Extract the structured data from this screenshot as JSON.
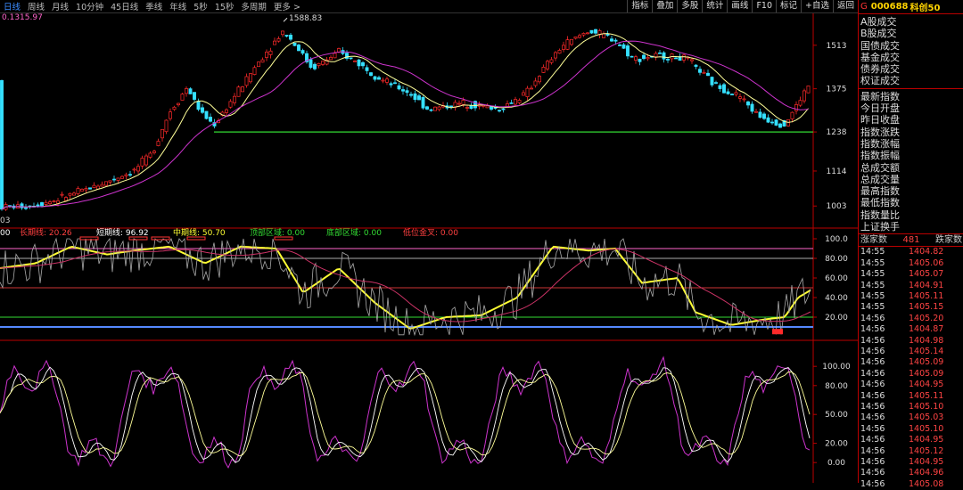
{
  "periods": [
    "日线",
    "周线",
    "月线",
    "10分钟",
    "45日线",
    "季线",
    "年线",
    "5秒",
    "15秒",
    "多周期",
    "更多 >"
  ],
  "active_period_index": 0,
  "tools": [
    "指标",
    "叠加",
    "多股",
    "统计",
    "画线",
    "F10",
    "标记",
    "+自选",
    "返回"
  ],
  "stock": {
    "flag": "G",
    "code": "000688",
    "name": "科创50"
  },
  "main_chart": {
    "top_left_value": "0.1315.97",
    "bottom_left_label": "03",
    "high_marker": "1588.83",
    "price_axis": [
      "1513",
      "1375",
      "1238",
      "1114",
      "1003"
    ],
    "support_line": 1238
  },
  "indicator1": {
    "legend": [
      {
        "text": "00",
        "color": "#ffffff"
      },
      {
        "text": "长期线: 20.26",
        "color": "#ff4040"
      },
      {
        "text": "短期线: 96.92",
        "color": "#ffffff"
      },
      {
        "text": "中期线: 50.70",
        "color": "#ffff33"
      },
      {
        "text": "顶部区域: 0.00",
        "color": "#33dd33"
      },
      {
        "text": "底部区域: 0.00",
        "color": "#33dd33"
      },
      {
        "text": "低位金叉: 0.00",
        "color": "#ff4040"
      }
    ],
    "axis": [
      "100.0",
      "80.00",
      "60.00",
      "40.00",
      "20.00"
    ]
  },
  "indicator2": {
    "axis": [
      "100.00",
      "80.00",
      "50.00",
      "20.00",
      "0.00"
    ]
  },
  "menu": {
    "group1": [
      "A股成交",
      "B股成交",
      "国债成交",
      "基金成交",
      "债券成交",
      "权证成交"
    ],
    "group2": [
      "最新指数",
      "今日开盘",
      "昨日收盘",
      "指数涨跌",
      "指数涨幅",
      "指数振幅",
      "总成交额",
      "总成交量",
      "最高指数",
      "最低指数",
      "指数量比",
      "上证换手"
    ]
  },
  "breadth": {
    "up_label": "涨家数",
    "up_value": "481",
    "down_label": "跌家数"
  },
  "ticks": [
    {
      "time": "14:55",
      "price": "1404.82"
    },
    {
      "time": "14:55",
      "price": "1405.06"
    },
    {
      "time": "14:55",
      "price": "1405.07"
    },
    {
      "time": "14:55",
      "price": "1404.91"
    },
    {
      "time": "14:55",
      "price": "1405.11"
    },
    {
      "time": "14:55",
      "price": "1405.15"
    },
    {
      "time": "14:56",
      "price": "1405.20"
    },
    {
      "time": "14:56",
      "price": "1404.87"
    },
    {
      "time": "14:56",
      "price": "1404.98"
    },
    {
      "time": "14:56",
      "price": "1405.14"
    },
    {
      "time": "14:56",
      "price": "1405.09"
    },
    {
      "time": "14:56",
      "price": "1405.09"
    },
    {
      "time": "14:56",
      "price": "1404.95"
    },
    {
      "time": "14:56",
      "price": "1405.11"
    },
    {
      "time": "14:56",
      "price": "1405.10"
    },
    {
      "time": "14:56",
      "price": "1405.03"
    },
    {
      "time": "14:56",
      "price": "1405.10"
    },
    {
      "time": "14:56",
      "price": "1404.95"
    },
    {
      "time": "14:56",
      "price": "1405.12"
    },
    {
      "time": "14:56",
      "price": "1404.95"
    },
    {
      "time": "14:56",
      "price": "1404.96"
    },
    {
      "time": "14:56",
      "price": "1405.08"
    }
  ],
  "colors": {
    "up": "#ff2a2a",
    "down": "#35e0ff",
    "ma1": "#ffff99",
    "ma2": "#cc33cc",
    "support": "#33dd33"
  }
}
